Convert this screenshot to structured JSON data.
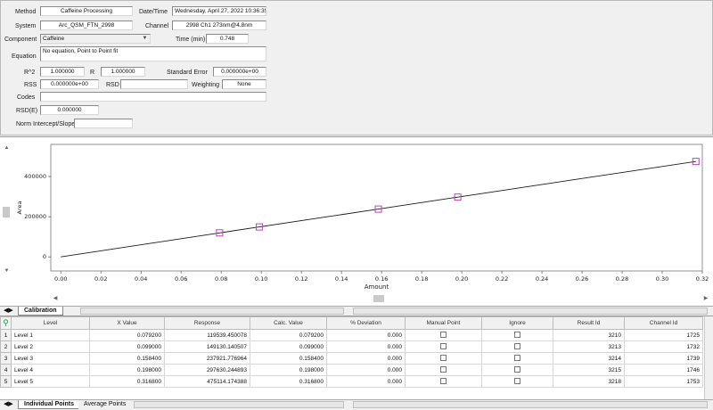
{
  "properties": {
    "method_label": "Method",
    "method_value": "Caffeine Processing",
    "datetime_label": "Date/Time",
    "datetime_value": "Wednesday, April 27, 2022 10:36:39",
    "system_label": "System",
    "system_value": "Arc_QSM_FTN_2998",
    "channel_label": "Channel",
    "channel_value": "2998 Ch1 273nm@4.8nm",
    "component_label": "Component",
    "component_value": "Caffeine",
    "time_label": "Time (min)",
    "time_value": "0.748",
    "equation_label": "Equation",
    "equation_value": "No equation, Point to Point fit",
    "r2_label": "R^2",
    "r2_value": "1.000000",
    "r_label": "R",
    "r_value": "1.000000",
    "stderr_label": "Standard Error",
    "stderr_value": "0.000000e+00",
    "rss_label": "RSS",
    "rss_value": "0.000000e+00",
    "rsd_label": "RSD",
    "rsd_value": "",
    "weighting_label": "Weighting",
    "weighting_value": "None",
    "codes_label": "Codes",
    "codes_value": "",
    "rsde_label": "RSD(E)",
    "rsde_value": "0.000000",
    "norm_label": "Norm Intercept/Slope",
    "norm_value": ""
  },
  "chart_data": {
    "type": "scatter",
    "xlabel": "Amount",
    "ylabel": "Area",
    "xlim": [
      -0.005,
      0.32
    ],
    "ylim": [
      -70000,
      560000
    ],
    "x_ticks": [
      "0.00",
      "0.02",
      "0.04",
      "0.06",
      "0.08",
      "0.10",
      "0.12",
      "0.14",
      "0.16",
      "0.18",
      "0.20",
      "0.22",
      "0.24",
      "0.26",
      "0.28",
      "0.30",
      "0.32"
    ],
    "y_ticks": [
      "0",
      "200000",
      "400000"
    ],
    "x_tick_values": [
      0,
      0.02,
      0.04,
      0.06,
      0.08,
      0.1,
      0.12,
      0.14,
      0.16,
      0.18,
      0.2,
      0.22,
      0.24,
      0.26,
      0.28,
      0.3,
      0.32
    ],
    "y_tick_values": [
      0,
      200000,
      400000
    ],
    "points": [
      {
        "x": 0.0792,
        "y": 119539.45
      },
      {
        "x": 0.099,
        "y": 149130.14
      },
      {
        "x": 0.1584,
        "y": 237921.78
      },
      {
        "x": 0.198,
        "y": 297630.24
      },
      {
        "x": 0.3168,
        "y": 475114.17
      }
    ],
    "line": [
      {
        "x": 0.0,
        "y": 0
      },
      {
        "x": 0.0792,
        "y": 119539.45
      },
      {
        "x": 0.099,
        "y": 149130.14
      },
      {
        "x": 0.1584,
        "y": 237921.78
      },
      {
        "x": 0.198,
        "y": 297630.24
      },
      {
        "x": 0.3168,
        "y": 475114.17
      }
    ],
    "line_color": "#1a1a1a",
    "marker_color": "#c040c0"
  },
  "tabs_top": {
    "calibration": "Calibration"
  },
  "tabs_bottom": {
    "individual": "Individual Points",
    "average": "Average Points"
  },
  "grid": {
    "headers": [
      "Level",
      "X Value",
      "Response",
      "Calc. Value",
      "% Deviation",
      "Manual Point",
      "Ignore",
      "Result Id",
      "Channel Id"
    ],
    "rows": [
      {
        "n": "1",
        "level": "Level 1",
        "x": "0.079200",
        "response": "119539.450078",
        "calc": "0.079200",
        "dev": "0.000",
        "result": "3210",
        "channel": "1725"
      },
      {
        "n": "2",
        "level": "Level 2",
        "x": "0.099000",
        "response": "149130.140507",
        "calc": "0.099000",
        "dev": "0.000",
        "result": "3213",
        "channel": "1732"
      },
      {
        "n": "3",
        "level": "Level 3",
        "x": "0.158400",
        "response": "237921.776964",
        "calc": "0.158400",
        "dev": "0.000",
        "result": "3214",
        "channel": "1739"
      },
      {
        "n": "4",
        "level": "Level 4",
        "x": "0.198000",
        "response": "297630.244893",
        "calc": "0.198000",
        "dev": "0.000",
        "result": "3215",
        "channel": "1746"
      },
      {
        "n": "5",
        "level": "Level 5",
        "x": "0.316800",
        "response": "475114.174388",
        "calc": "0.316800",
        "dev": "0.000",
        "result": "3218",
        "channel": "1753"
      }
    ]
  }
}
